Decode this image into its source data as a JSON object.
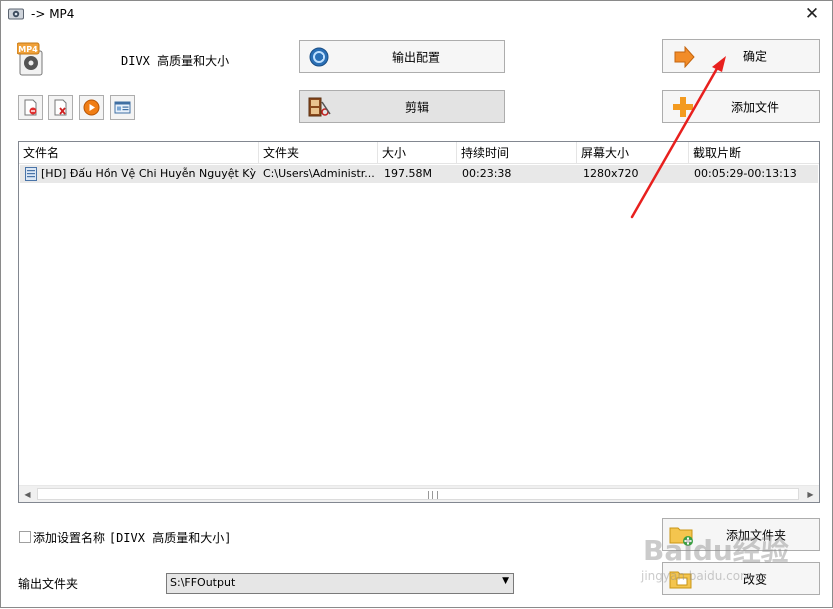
{
  "window": {
    "title": "-> MP4",
    "close_glyph": "✕"
  },
  "preset": {
    "badge_text": "MP4",
    "name": "DIVX 高质量和大小"
  },
  "toolbar": {
    "config_label": "输出配置",
    "edit_label": "剪辑",
    "ok_label": "确定",
    "add_file_label": "添加文件",
    "add_folder_label": "添加文件夹",
    "change_label": "改变",
    "small_icons": [
      "remove-file-icon",
      "clear-list-icon",
      "play-icon",
      "media-info-icon"
    ]
  },
  "file_list": {
    "columns": [
      "文件名",
      "文件夹",
      "大小",
      "持续时间",
      "屏幕大小",
      "截取片断"
    ],
    "rows": [
      {
        "name": "[HD] Đấu Hồn Vệ Chi Huyễn Nguyệt Kỳ Du...",
        "folder": "C:\\Users\\Administr...",
        "size": "197.58M",
        "duration": "00:23:38",
        "resolution": "1280x720",
        "clip": "00:05:29-00:13:13"
      }
    ]
  },
  "options": {
    "add_setting_name_label": "添加设置名称",
    "add_setting_name_value": "[DIVX 高质量和大小]",
    "add_setting_name_checked": false
  },
  "output": {
    "label": "输出文件夹",
    "folder": "S:\\FFOutput"
  },
  "annotation": {
    "arrow_color": "#e8201e"
  },
  "watermark": {
    "text": "Baidu经验",
    "url": "jingyan.baidu.com"
  }
}
